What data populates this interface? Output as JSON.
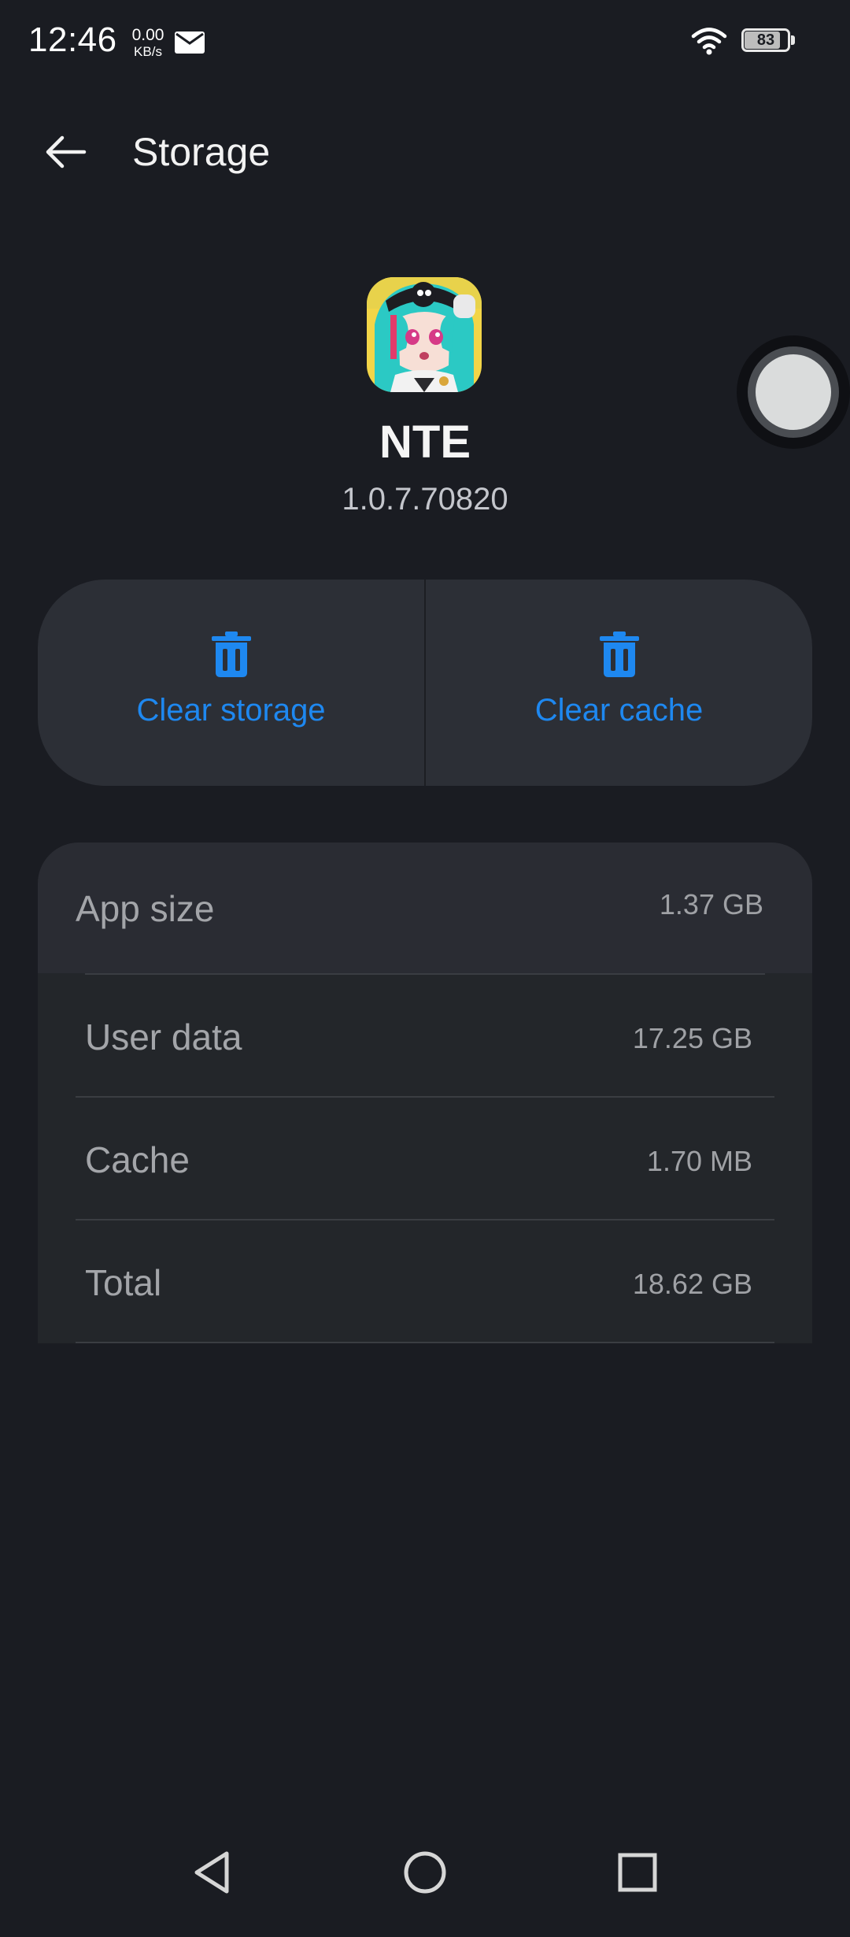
{
  "status_bar": {
    "time": "12:46",
    "net_speed_value": "0.00",
    "net_speed_unit": "KB/s",
    "battery_level": "83",
    "icons": [
      "mail-icon",
      "wifi-icon",
      "battery-icon"
    ]
  },
  "header": {
    "back_icon": "arrow-left-icon",
    "title": "Storage"
  },
  "app": {
    "name": "NTE",
    "version": "1.0.7.70820",
    "icon": "app-icon-anime-character"
  },
  "actions": {
    "clear_storage_label": "Clear storage",
    "clear_cache_label": "Clear cache",
    "icon": "trash-icon",
    "accent_color": "#1e88f0"
  },
  "storage": {
    "app_size_label": "App size",
    "app_size_value": "1.37 GB",
    "user_data_label": "User data",
    "user_data_value": "17.25 GB",
    "cache_label": "Cache",
    "cache_value": "1.70 MB",
    "total_label": "Total",
    "total_value": "18.62 GB"
  },
  "nav": {
    "back_icon": "triangle-back-icon",
    "home_icon": "circle-home-icon",
    "recents_icon": "square-recents-icon"
  },
  "floating_ball": {
    "icon": "assistive-ball-icon"
  }
}
